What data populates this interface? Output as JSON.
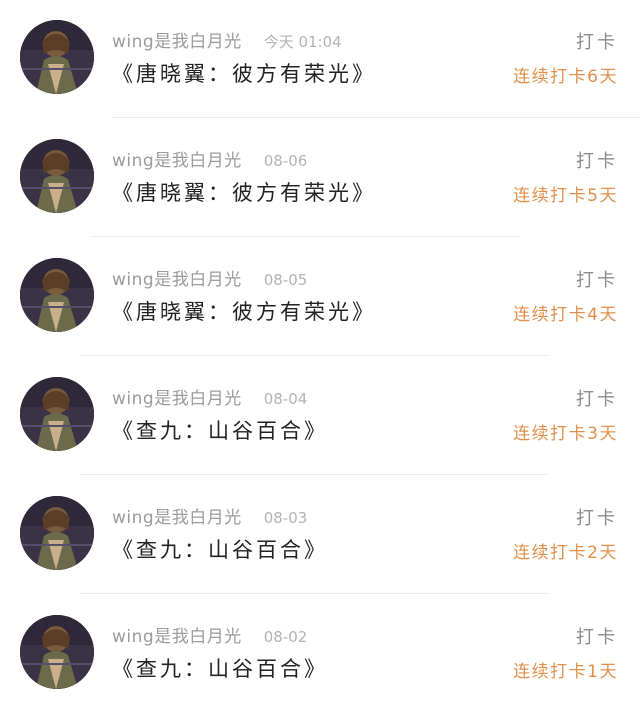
{
  "feed": {
    "items": [
      {
        "username": "wing是我白月光",
        "time": "今天 01:04",
        "title": "《唐晓翼：彼方有荣光》",
        "action_label": "打卡",
        "streak": "连续打卡6天"
      },
      {
        "username": "wing是我白月光",
        "time": "08-06",
        "title": "《唐晓翼：彼方有荣光》",
        "action_label": "打卡",
        "streak": "连续打卡5天"
      },
      {
        "username": "wing是我白月光",
        "time": "08-05",
        "title": "《唐晓翼：彼方有荣光》",
        "action_label": "打卡",
        "streak": "连续打卡4天"
      },
      {
        "username": "wing是我白月光",
        "time": "08-04",
        "title": "《查九：山谷百合》",
        "action_label": "打卡",
        "streak": "连续打卡3天"
      },
      {
        "username": "wing是我白月光",
        "time": "08-03",
        "title": "《查九：山谷百合》",
        "action_label": "打卡",
        "streak": "连续打卡2天"
      },
      {
        "username": "wing是我白月光",
        "time": "08-02",
        "title": "《查九：山谷百合》",
        "action_label": "打卡",
        "streak": "连续打卡1天"
      }
    ]
  },
  "colors": {
    "streak_accent": "#e0904a",
    "username": "#9b9b9b",
    "title": "#222222",
    "divider": "#eeeeee"
  }
}
